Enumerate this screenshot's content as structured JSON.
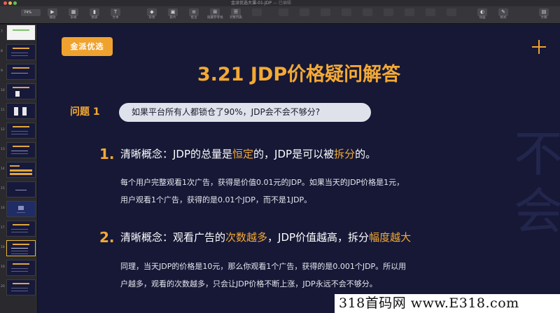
{
  "window": {
    "title": "金派优选大课-01-JDP",
    "edited": "— 已编辑"
  },
  "toolbar": {
    "zoom": "74%",
    "items": [
      {
        "label": "播放",
        "icon": "play-icon",
        "glyph": "▶"
      },
      {
        "label": "表格",
        "icon": "table-icon",
        "glyph": "▦"
      },
      {
        "label": "图表",
        "icon": "chart-icon",
        "glyph": "▮"
      },
      {
        "label": "文本",
        "icon": "text-icon",
        "glyph": "T"
      },
      {
        "label": "形状",
        "icon": "shape-icon",
        "glyph": "◆"
      },
      {
        "label": "影片",
        "icon": "media-icon",
        "glyph": "▣"
      },
      {
        "label": "批注",
        "icon": "comment-icon",
        "glyph": "≡"
      },
      {
        "label": "隐藏参考线",
        "icon": "guides-icon",
        "glyph": "⊞"
      },
      {
        "label": "对象列表",
        "icon": "list-icon",
        "glyph": "☰"
      },
      {
        "label": "动画",
        "icon": "animate-icon",
        "glyph": "◐"
      },
      {
        "label": "格式",
        "icon": "format-icon",
        "glyph": "✎"
      },
      {
        "label": "文稿",
        "icon": "document-icon",
        "glyph": "▤"
      }
    ]
  },
  "sidebar": {
    "slides": [
      {
        "num": "7"
      },
      {
        "num": "8"
      },
      {
        "num": "9"
      },
      {
        "num": "10"
      },
      {
        "num": "11"
      },
      {
        "num": "12"
      },
      {
        "num": "13"
      },
      {
        "num": "14"
      },
      {
        "num": "15"
      },
      {
        "num": "16"
      },
      {
        "num": "17"
      },
      {
        "num": "18"
      },
      {
        "num": "19"
      },
      {
        "num": "20"
      }
    ],
    "selected_num": "18"
  },
  "slide": {
    "brand": "金派优选",
    "title": "3.21 JDP价格疑问解答",
    "question_label": "问题 1",
    "question": "如果平台所有人都锁仓了90%，JDP会不会不够分?",
    "points": [
      {
        "num": "1.",
        "head_a": "清晰概念：JDP的总量是",
        "head_hl1": "恒定",
        "head_b": "的，JDP是可以被",
        "head_hl2": "拆分",
        "head_c": "的。",
        "line1": "每个用户完整观看1次广告，获得是价值0.01元的JDP。如果当天的JDP价格是1元，",
        "line2": "用户观看1个广告，获得的是0.01个JDP，而不是1JDP。"
      },
      {
        "num": "2.",
        "head_a": "清晰概念：观看广告的",
        "head_hl1": "次数越多",
        "head_b": "，JDP价值越高，拆分",
        "head_hl2": "幅度越大",
        "head_c": "",
        "line1": "同理，当天JDP的价格是10元，那么你观看1个广告，获得的是0.001个JDP。所以用",
        "line2": "户越多，观看的次数越多，只会让JDP价格不断上涨，JDP永远不会不够分。"
      }
    ],
    "side_chars": [
      "不",
      "会"
    ]
  },
  "watermark": "318首码网 www.E318.com",
  "colors": {
    "accent": "#f3a935",
    "slide_bg": "#161836",
    "pill_bg": "#dfe2ea"
  }
}
